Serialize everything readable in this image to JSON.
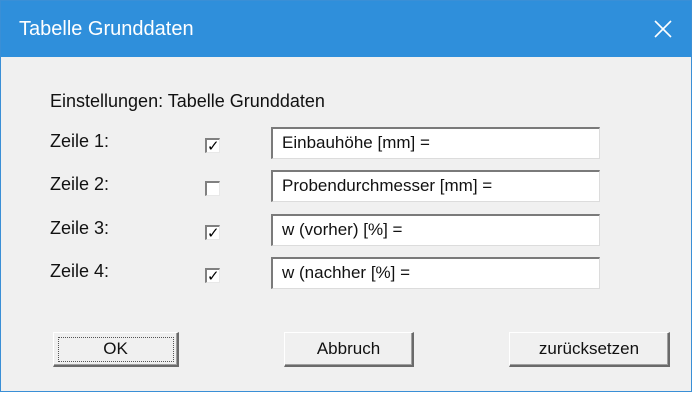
{
  "window": {
    "title": "Tabelle Grunddaten",
    "close_symbol": "×"
  },
  "heading": "Einstellungen: Tabelle Grunddaten",
  "rows": [
    {
      "label": "Zeile 1:",
      "checked": true,
      "value": "Einbauhöhe [mm] ="
    },
    {
      "label": "Zeile 2:",
      "checked": false,
      "value": "Probendurchmesser [mm] ="
    },
    {
      "label": "Zeile 3:",
      "checked": true,
      "value": "w (vorher) [%] ="
    },
    {
      "label": "Zeile 4:",
      "checked": true,
      "value": "w (nachher [%] ="
    }
  ],
  "buttons": {
    "ok": "OK",
    "cancel": "Abbruch",
    "reset": "zurücksetzen"
  },
  "colors": {
    "titlebar": "#2f8fdb",
    "dialog_bg": "#f0f0f0"
  },
  "icons": {
    "close": "close-icon",
    "check": "checkmark-icon"
  }
}
